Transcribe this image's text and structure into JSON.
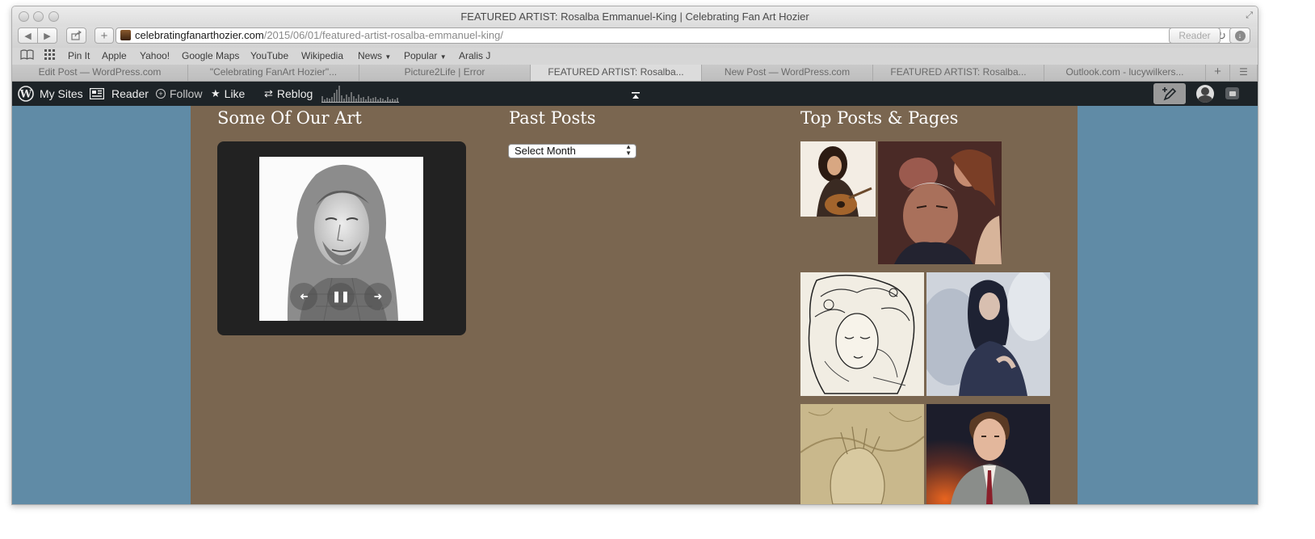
{
  "browser": {
    "window_title": "FEATURED ARTIST: Rosalba Emmanuel-King | Celebrating Fan Art Hozier",
    "url_domain": "celebratingfanarthozier.com",
    "url_path": "/2015/06/01/featured-artist-rosalba-emmanuel-king/",
    "reader_label": "Reader",
    "bookmarks": [
      "Pin It",
      "Apple",
      "Yahoo!",
      "Google Maps",
      "YouTube",
      "Wikipedia",
      "News",
      "Popular",
      "Aralis J"
    ],
    "tabs": [
      "Edit Post — WordPress.com",
      "\"Celebrating FanArt Hozier\"...",
      "Picture2Life | Error",
      "FEATURED ARTIST: Rosalba...",
      "New Post — WordPress.com",
      "FEATURED ARTIST: Rosalba...",
      "Outlook.com - lucywilkers..."
    ],
    "active_tab_index": 3
  },
  "wp_toolbar": {
    "my_sites": "My Sites",
    "reader": "Reader",
    "follow": "Follow",
    "like": "Like",
    "reblog": "Reblog"
  },
  "widgets": {
    "art_heading": "Some Of Our Art",
    "past_heading": "Past Posts",
    "archive_select": "Select Month",
    "top_heading": "Top Posts & Pages"
  },
  "colors": {
    "page_bg": "#608ba6",
    "content_bg": "#7a6650",
    "wpbar_bg": "#1d2327"
  }
}
